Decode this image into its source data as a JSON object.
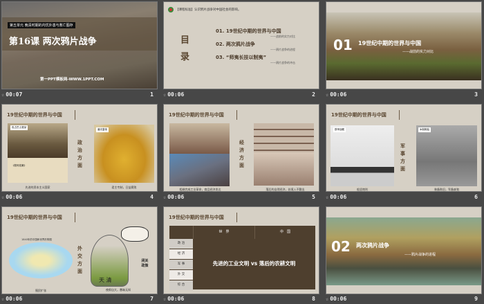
{
  "slides": [
    {
      "num": "1",
      "time": "00:07",
      "unit": "第五单元  晚清时期的内忧外患与救亡图存",
      "title": "第16课  两次鸦片战争",
      "site": "第一PPT模板网-WWW.1PPT.COM"
    },
    {
      "num": "2",
      "time": "00:06",
      "standard": "【课程标准】认识鸦片战争对中国社会的影响。",
      "toc_title": "目录",
      "items": [
        {
          "label": "01.  19世纪中期的世界与中国",
          "sub": "——战前的实力对比"
        },
        {
          "label": "02.  两次鸦片战争",
          "sub": "——鸦片战争的进程"
        },
        {
          "label": "03.  “师夷长技以制夷”",
          "sub": "——鸦片战争的冲击"
        }
      ]
    },
    {
      "num": "3",
      "time": "00:06",
      "index": "01",
      "title": "19世纪中期的世界与中国",
      "sub": "——战前的实力对比"
    },
    {
      "num": "4",
      "time": "00:06",
      "title": "19世纪中期的世界与中国",
      "aspect": "政治方面",
      "tag1": "攻占巴士底狱",
      "tag2": "《权利法案》",
      "tag3": "道光皇帝",
      "cap1": "先进的资本主义国家",
      "cap2": "君主专制，日益腐败"
    },
    {
      "num": "5",
      "time": "00:06",
      "title": "19世纪中期的世界与中国",
      "aspect": "经济方面",
      "cap1": "相继完成工业革命，商品经济发达",
      "cap2": "落后的自然经济，处境入不敷出"
    },
    {
      "num": "6",
      "time": "00:06",
      "title": "19世纪中期的世界与中国",
      "aspect": "军事方面",
      "tag1": "铁甲战舰",
      "tag2": "木制帆船",
      "cap1": "船坚炮利",
      "cap2": "装备陈旧，军备废弛"
    },
    {
      "num": "7",
      "time": "00:06",
      "title": "19世纪中期的世界与中国",
      "aspect": "外交方面",
      "map_title": "1840年的中国和世界形势图",
      "policy": "闭关政策",
      "cage_text": "天 清",
      "cap1": "殖民扩张",
      "cap2": "夜郎自大，愚昧无知"
    },
    {
      "num": "8",
      "time": "00:06",
      "title": "19世纪中期的世界与中国",
      "col1": "世　界",
      "col2": "中　国",
      "rows": [
        "政 治",
        "经 济",
        "军 事",
        "外 交",
        "综 合"
      ],
      "summary": "先进的工业文明 vs 落后的农耕文明"
    },
    {
      "num": "9",
      "time": "00:06",
      "index": "02",
      "title": "两次鸦片战争",
      "sub": "——鸦片战争的进程"
    }
  ]
}
